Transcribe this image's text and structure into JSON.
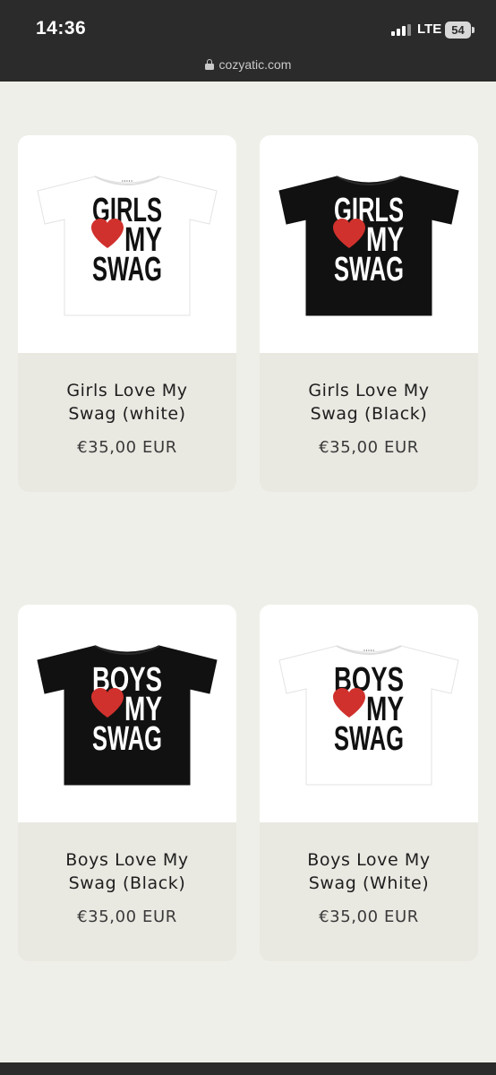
{
  "status_bar": {
    "time": "14:36",
    "network": "LTE",
    "battery": "54"
  },
  "browser": {
    "url": "cozyatic.com"
  },
  "products": [
    {
      "title_line1": "Girls Love My",
      "title_line2": "Swag (white)",
      "price": "€35,00 EUR",
      "shirt": {
        "color": "#ffffff",
        "text_color": "#111111",
        "word1": "GIRLS",
        "word2": "MY",
        "word3": "SWAG",
        "heart_color": "#d0312d"
      }
    },
    {
      "title_line1": "Girls Love My",
      "title_line2": "Swag (Black)",
      "price": "€35,00 EUR",
      "shirt": {
        "color": "#111111",
        "text_color": "#ffffff",
        "word1": "GIRLS",
        "word2": "MY",
        "word3": "SWAG",
        "heart_color": "#d0312d"
      }
    },
    {
      "title_line1": "Boys Love My",
      "title_line2": "Swag (Black)",
      "price": "€35,00 EUR",
      "shirt": {
        "color": "#111111",
        "text_color": "#ffffff",
        "word1": "BOYS",
        "word2": "MY",
        "word3": "SWAG",
        "heart_color": "#d0312d"
      }
    },
    {
      "title_line1": "Boys Love My",
      "title_line2": "Swag (White)",
      "price": "€35,00 EUR",
      "shirt": {
        "color": "#ffffff",
        "text_color": "#111111",
        "word1": "BOYS",
        "word2": "MY",
        "word3": "SWAG",
        "heart_color": "#d0312d"
      }
    }
  ]
}
